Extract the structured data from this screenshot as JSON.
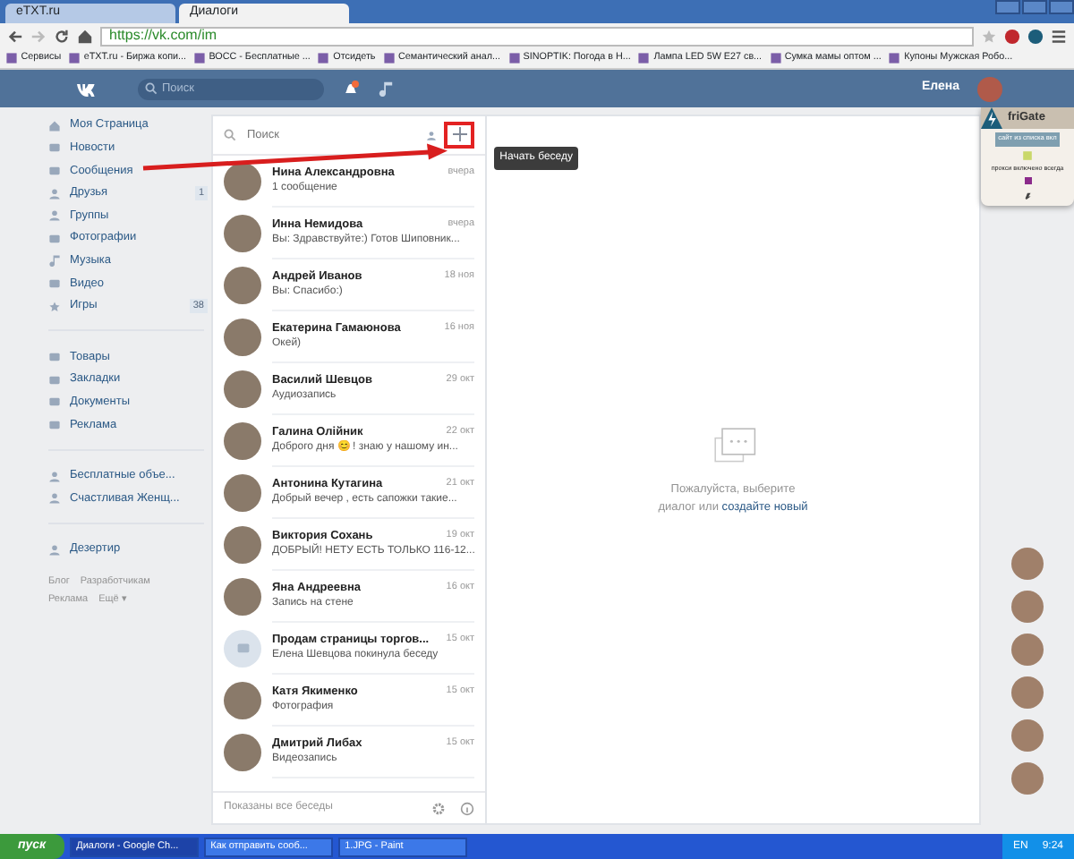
{
  "browser": {
    "tabs": [
      {
        "label": "eTXT.ru",
        "selected": false
      },
      {
        "label": "Диалоги",
        "selected": true
      }
    ],
    "url": "https://vk.com/im",
    "bookmarks": [
      "Сервисы",
      "eTXT.ru - Биржа копи...",
      "ВОСС - Бесплатные ...",
      "Отсидеть",
      "Семантический анал...",
      "SINOPTIK: Погода в Н...",
      "Лампа LED 5W E27 св...",
      "Сумка мамы оптом ...",
      "Купоны Мужская Робо..."
    ]
  },
  "header": {
    "search_placeholder": "Поиск",
    "user_name": "Елена"
  },
  "nav": {
    "groups": [
      [
        {
          "label": "Моя Страница"
        },
        {
          "label": "Новости"
        },
        {
          "label": "Сообщения"
        },
        {
          "label": "Друзья",
          "badge": "1"
        },
        {
          "label": "Группы"
        },
        {
          "label": "Фотографии"
        },
        {
          "label": "Музыка"
        },
        {
          "label": "Видео"
        },
        {
          "label": "Игры",
          "badge": "38"
        }
      ],
      [
        {
          "label": "Товары"
        },
        {
          "label": "Закладки"
        },
        {
          "label": "Документы"
        },
        {
          "label": "Реклама"
        }
      ],
      [
        {
          "label": "Бесплатные объе..."
        },
        {
          "label": "Счастливая Женщ..."
        }
      ],
      [
        {
          "label": "Дезертир"
        }
      ]
    ],
    "footer_links": [
      "Блог",
      "Разработчикам",
      "Реклама",
      "Ещё ▾"
    ]
  },
  "dialogs": {
    "search_placeholder": "Поиск",
    "new_chat_tooltip": "Начать беседу",
    "items": [
      {
        "name": "Нина Александровна",
        "time": "вчера",
        "preview": "1 сообщение",
        "kind": "photo"
      },
      {
        "name": "Инна Немидова",
        "time": "вчера",
        "preview": "Вы: Здравствуйте:) Готов Шиповник...",
        "kind": "photo"
      },
      {
        "name": "Андрей Иванов",
        "time": "18 ноя",
        "preview": "Вы: Спасибо:)",
        "kind": "photo"
      },
      {
        "name": "Екатерина Гамаюнова",
        "time": "16 ноя",
        "preview": "Окей)",
        "kind": "photo"
      },
      {
        "name": "Василий Шевцов",
        "time": "29 окт",
        "preview": "Аудиозапись",
        "kind": "photo"
      },
      {
        "name": "Галина Олійник",
        "time": "22 окт",
        "preview": "Доброго дня 😊 ! знаю у нашому ин...",
        "kind": "photo"
      },
      {
        "name": "Антонина Кутагина",
        "time": "21 окт",
        "preview": "Добрый вечер , есть сапожки такие...",
        "kind": "photo"
      },
      {
        "name": "Виктория Сохань",
        "time": "19 окт",
        "preview": "ДОБРЫЙ! НЕТУ ЕСТЬ ТОЛЬКО 116-12...",
        "kind": "photo"
      },
      {
        "name": "Яна Андреевна",
        "time": "16 окт",
        "preview": "Запись на стене",
        "kind": "photo"
      },
      {
        "name": "Продам страницы торгов...",
        "time": "15 окт",
        "preview": "Елена Шевцова покинула беседу",
        "kind": "group"
      },
      {
        "name": "Катя Якименко",
        "time": "15 окт",
        "preview": "Фотография",
        "kind": "photo"
      },
      {
        "name": "Дмитрий Либах",
        "time": "15 окт",
        "preview": "Видеозапись",
        "kind": "photo"
      }
    ],
    "footer": "Показаны все беседы"
  },
  "empty_state": {
    "text": "Пожалуйста, выберите диалог или",
    "link": "создайте новый"
  },
  "frigate": {
    "title": "friGate",
    "status": "сайт из списка вкл",
    "mode": "прокси включено всегда"
  },
  "taskbar": {
    "start": "пуск",
    "tasks": [
      {
        "label": "Диалоги - Google Ch...",
        "selected": true
      },
      {
        "label": "Как отправить сооб...",
        "selected": false
      },
      {
        "label": "1.JPG - Paint",
        "selected": false
      }
    ],
    "lang": "EN",
    "clock": "9:24"
  }
}
